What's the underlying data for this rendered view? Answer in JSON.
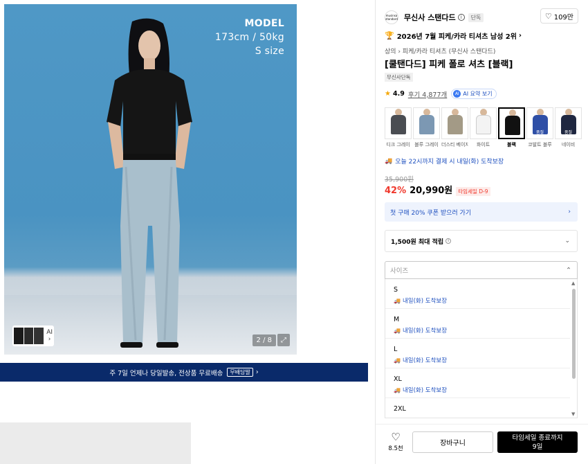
{
  "hero": {
    "model_title": "MODEL",
    "model_size": "173cm / 50kg",
    "model_fit": "S size",
    "thumb_ai_label": "AI",
    "thumb_chevron": "›",
    "page_indicator": "2 / 8",
    "expand_icon": "⤢"
  },
  "promo_bar": {
    "text": "주 7일 언제나 당일발송, 전상품 무료배송",
    "tag": "무배당발",
    "chevron": "›"
  },
  "brand": {
    "logo_text": "musinsa standard",
    "name": "무신사 스탠다드",
    "info_icon": "i",
    "exclusive": "단독",
    "like_count": "109만"
  },
  "rank": {
    "text": "2026년 7월 피케/카라 티셔츠 남성 2위",
    "chevron": "›"
  },
  "breadcrumb": "상의 › 피케/카라 티셔츠 (무신사 스탠다드)",
  "product_title": "[쿨탠다드] 피케 폴로 셔츠 [블랙]",
  "store_badge": "무신사단독",
  "rating": {
    "score": "4.9",
    "review_link": "후기 4,877개",
    "ai_summary": "AI 요약 보기",
    "ai_dot": "AI"
  },
  "colors": [
    {
      "label": "디크 그레이",
      "color": "#4a4d52",
      "overlay": ""
    },
    {
      "label": "블루 그레이",
      "color": "#7c98b3",
      "overlay": ""
    },
    {
      "label": "더스티 베이지",
      "color": "#a39a86",
      "overlay": ""
    },
    {
      "label": "화이트",
      "color": "#f3f3f3",
      "overlay": ""
    },
    {
      "label": "블랙",
      "color": "#111111",
      "overlay": ""
    },
    {
      "label": "코발트 블루",
      "color": "#2f4fa6",
      "overlay": "품절"
    },
    {
      "label": "네이비",
      "color": "#1f2740",
      "overlay": "품절"
    }
  ],
  "delivery": "오늘 22시까지 결제 시 내일(화) 도착보장",
  "price": {
    "original": "35,900원",
    "discount": "42%",
    "final": "20,990원",
    "timesale": "타임세일 D-9"
  },
  "coupon": {
    "text": "첫 구매 20% 쿠폰 받으러 가기",
    "chevron": "›"
  },
  "points": {
    "text": "1,500원 최대 적립",
    "info": "i",
    "chevron": "⌄"
  },
  "size": {
    "placeholder": "사이즈",
    "chevron": "⌃",
    "options": [
      {
        "name": "S",
        "delivery": "내일(화) 도착보장"
      },
      {
        "name": "M",
        "delivery": "내일(화) 도착보장"
      },
      {
        "name": "L",
        "delivery": "내일(화) 도착보장"
      },
      {
        "name": "XL",
        "delivery": "내일(화) 도착보장"
      },
      {
        "name": "2XL",
        "delivery": ""
      }
    ],
    "scroll_up": "▲",
    "scroll_down": "▼"
  },
  "bottom": {
    "wish_count": "8.5천",
    "cart_label": "장바구니",
    "buy_line1": "타임세일 종료까지",
    "buy_line2": "9일"
  }
}
